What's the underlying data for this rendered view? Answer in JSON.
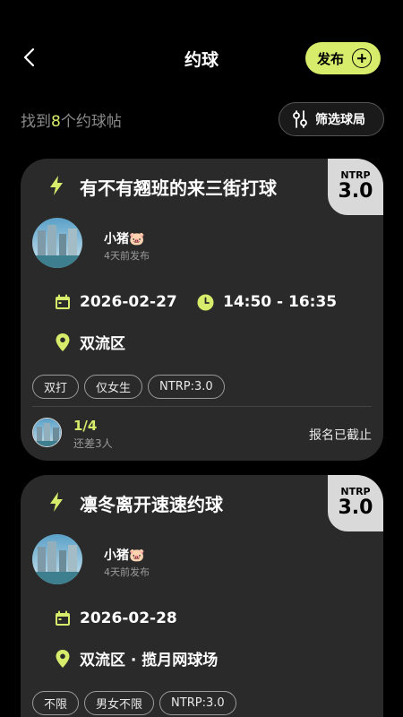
{
  "header": {
    "title": "约球",
    "publish_label": "发布"
  },
  "summary": {
    "prefix": "找到",
    "count": "8",
    "suffix": "个约球帖"
  },
  "filter": {
    "label": "筛选球局"
  },
  "colors": {
    "accent": "#d6ec6a",
    "card": "#2a2a2a",
    "background": "#000000",
    "badge": "#d9d9d9"
  },
  "cards": [
    {
      "title": "有不有翘班的来三街打球",
      "ntrp_label": "NTRP",
      "ntrp_value": "3.0",
      "user": "小猪🐷",
      "posted": "4天前发布",
      "date": "2026-02-27",
      "time": "14:50 - 16:35",
      "location": "双流区",
      "tags": [
        "双打",
        "仅女生",
        "NTRP:3.0"
      ],
      "slots": "1/4",
      "need": "还差3人",
      "status": "报名已截止"
    },
    {
      "title": "凛冬离开速速约球",
      "ntrp_label": "NTRP",
      "ntrp_value": "3.0",
      "user": "小猪🐷",
      "posted": "4天前发布",
      "date": "2026-02-28",
      "location": "双流区 · 揽月网球场",
      "tags": [
        "不限",
        "男女不限",
        "NTRP:3.0"
      ]
    }
  ]
}
